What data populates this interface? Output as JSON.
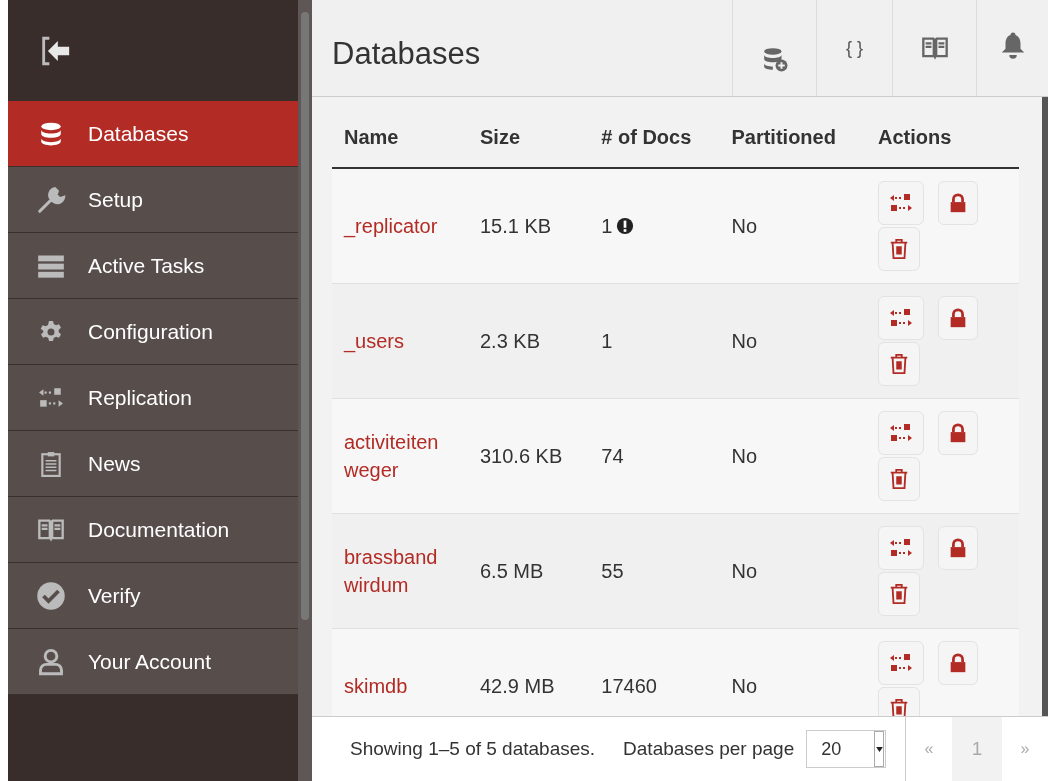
{
  "sidebar": {
    "items": [
      {
        "label": "Databases",
        "selected": true
      },
      {
        "label": "Setup",
        "selected": false
      },
      {
        "label": "Active Tasks",
        "selected": false
      },
      {
        "label": "Configuration",
        "selected": false
      },
      {
        "label": "Replication",
        "selected": false
      },
      {
        "label": "News",
        "selected": false
      },
      {
        "label": "Documentation",
        "selected": false
      },
      {
        "label": "Verify",
        "selected": false
      },
      {
        "label": "Your Account",
        "selected": false
      }
    ]
  },
  "header": {
    "title": "Databases",
    "json_button": "{ }"
  },
  "table": {
    "columns": [
      "Name",
      "Size",
      "# of Docs",
      "Partitioned",
      "Actions"
    ],
    "rows": [
      {
        "name": "_replicator",
        "size": "15.1 KB",
        "docs": "1",
        "warning": true,
        "partitioned": "No"
      },
      {
        "name": "_users",
        "size": "2.3 KB",
        "docs": "1",
        "warning": false,
        "partitioned": "No"
      },
      {
        "name": "activiteiten weger",
        "size": "310.6 KB",
        "docs": "74",
        "warning": false,
        "partitioned": "No"
      },
      {
        "name": "brassband wirdum",
        "size": "6.5 MB",
        "docs": "55",
        "warning": false,
        "partitioned": "No"
      },
      {
        "name": "skimdb",
        "size": "42.9 MB",
        "docs": "17460",
        "warning": false,
        "partitioned": "No"
      }
    ]
  },
  "footer": {
    "summary": "Showing 1–5 of 5 databases.",
    "per_page_label": "Databases per page",
    "per_page": "20",
    "pager": [
      {
        "label": "«",
        "selected": false
      },
      {
        "label": "1",
        "selected": true
      },
      {
        "label": "»",
        "selected": false
      }
    ]
  }
}
